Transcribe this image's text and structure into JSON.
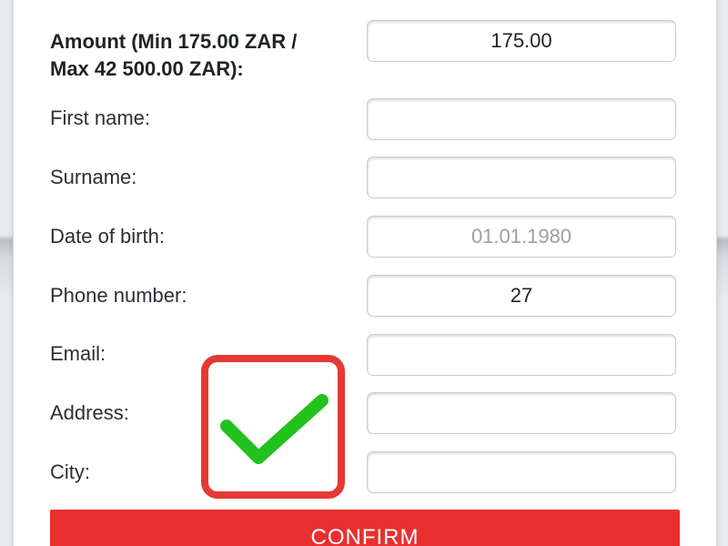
{
  "form": {
    "amount_label_line1": "Amount (Min 175.00 ZAR /",
    "amount_label_line2": "Max 42 500.00 ZAR):",
    "amount_value": "175.00",
    "first_name_label": "First name:",
    "first_name_value": "",
    "surname_label": "Surname:",
    "surname_value": "",
    "dob_label": "Date of birth:",
    "dob_placeholder": "01.01.1980",
    "phone_label": "Phone number:",
    "phone_value": "27",
    "email_label": "Email:",
    "email_value": "",
    "address_label": "Address:",
    "address_value": "",
    "city_label": "City:",
    "city_value": "",
    "confirm_label": "CONFIRM"
  },
  "overlay": {
    "icon": "checkmark-icon",
    "border_color": "#e53935",
    "check_color": "#22c21e"
  },
  "colors": {
    "confirm_button": "#e8302e"
  }
}
